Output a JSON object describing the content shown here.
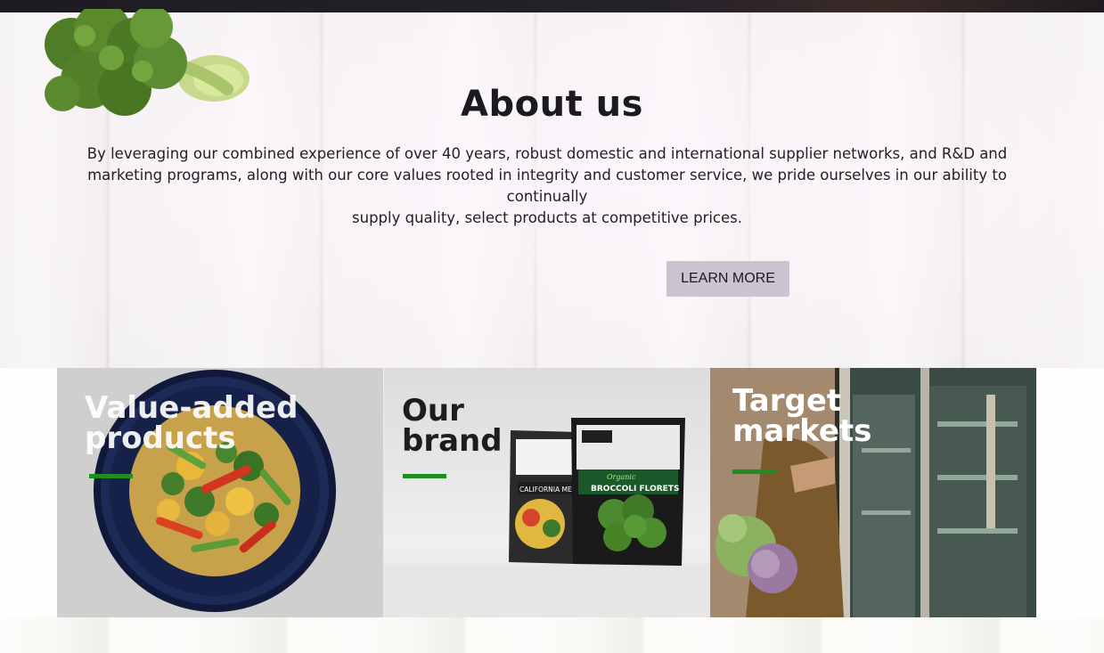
{
  "about": {
    "heading": "About us",
    "paragraph_lines": [
      "By leveraging our combined experience of over 40 years, robust domestic and international supplier networks, and R&D and",
      "marketing programs, along with our core values rooted in integrity and customer service, we pride ourselves in our ability to",
      "continually",
      "supply quality, select products at competitive prices."
    ],
    "button_label": "LEARN MORE"
  },
  "cards": [
    {
      "title": "Value-added\nproducts",
      "image": "stir-fry-plate-image"
    },
    {
      "title": "Our\nbrand",
      "image": "product-bags-image",
      "bag_labels": [
        "CALIFORNIA MEDL",
        "Organic",
        "BROCCOLI FLORETS"
      ]
    },
    {
      "title": "Target\nmarkets",
      "image": "shopper-grocery-image"
    }
  ],
  "colors": {
    "accent_green": "#1f8d1f",
    "button_bg": "#cbc4d0",
    "heading_text": "#1b1a1e",
    "top_bar": "#1d1b22"
  }
}
